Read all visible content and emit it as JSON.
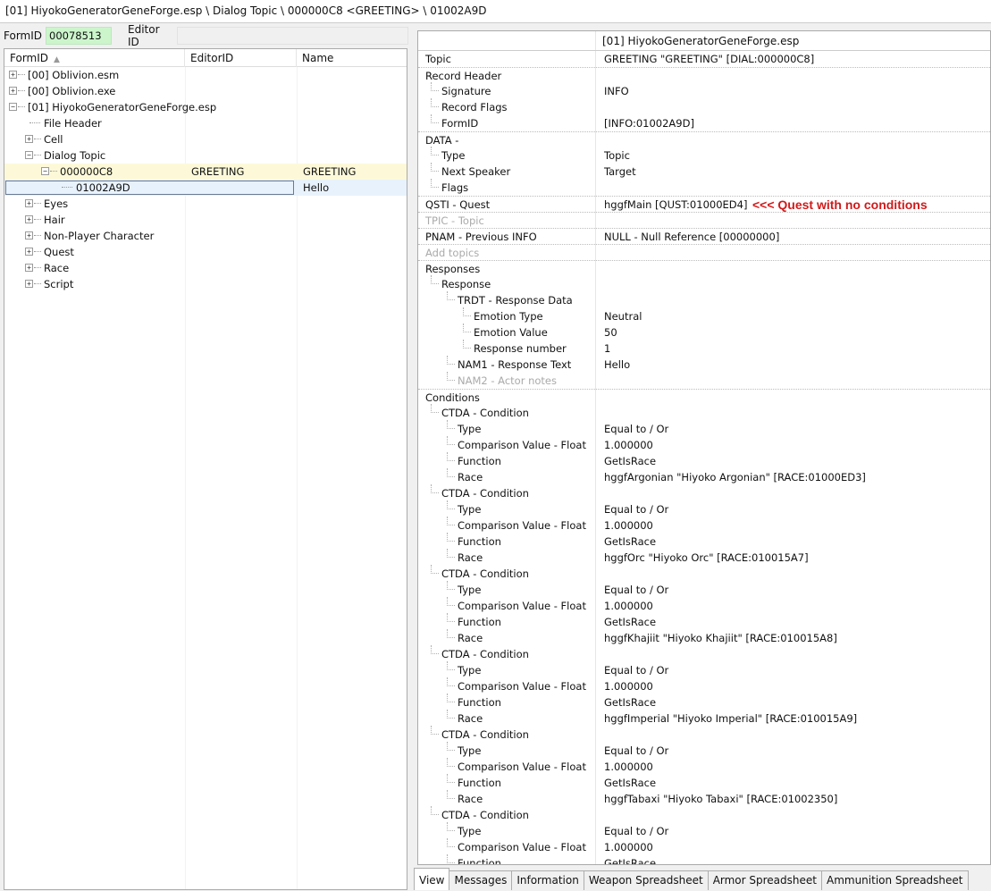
{
  "path": "[01] HiyokoGeneratorGeneForge.esp \\ Dialog Topic \\ 000000C8 <GREETING> \\ 01002A9D",
  "filter": {
    "formid_label": "FormID",
    "formid_value": "00078513",
    "editorid_label": "Editor ID"
  },
  "tree": {
    "columns": [
      "FormID",
      "EditorID",
      "Name"
    ],
    "rows": [
      {
        "label": "[00] Oblivion.esm",
        "editor": "",
        "name": ""
      },
      {
        "label": "[00] Oblivion.exe",
        "editor": "",
        "name": ""
      },
      {
        "label": "[01] HiyokoGeneratorGeneForge.esp",
        "editor": "",
        "name": ""
      },
      {
        "label": "File Header",
        "editor": "",
        "name": ""
      },
      {
        "label": "Cell",
        "editor": "",
        "name": ""
      },
      {
        "label": "Dialog Topic",
        "editor": "",
        "name": ""
      },
      {
        "label": "000000C8",
        "editor": "GREETING",
        "name": "GREETING"
      },
      {
        "label": "01002A9D",
        "editor": "",
        "name": "Hello"
      },
      {
        "label": "Eyes",
        "editor": "",
        "name": ""
      },
      {
        "label": "Hair",
        "editor": "",
        "name": ""
      },
      {
        "label": "Non-Player Character",
        "editor": "",
        "name": ""
      },
      {
        "label": "Quest",
        "editor": "",
        "name": ""
      },
      {
        "label": "Race",
        "editor": "",
        "name": ""
      },
      {
        "label": "Script",
        "editor": "",
        "name": ""
      }
    ]
  },
  "record": {
    "file_header": "[01] HiyokoGeneratorGeneForge.esp",
    "annotation": "<<< Quest with no conditions",
    "rows": [
      {
        "label": "Topic",
        "value": "GREETING \"GREETING\" [DIAL:000000C8]"
      },
      {
        "label": "Record Header",
        "value": ""
      },
      {
        "label": "Signature",
        "value": "INFO"
      },
      {
        "label": "Record Flags",
        "value": ""
      },
      {
        "label": "FormID",
        "value": "[INFO:01002A9D]"
      },
      {
        "label": "DATA -",
        "value": ""
      },
      {
        "label": "Type",
        "value": "Topic"
      },
      {
        "label": "Next Speaker",
        "value": "Target"
      },
      {
        "label": "Flags",
        "value": ""
      },
      {
        "label": "QSTI - Quest",
        "value": "hggfMain [QUST:01000ED4]"
      },
      {
        "label": "TPIC - Topic",
        "value": ""
      },
      {
        "label": "PNAM - Previous INFO",
        "value": "NULL - Null Reference [00000000]"
      },
      {
        "label": "Add topics",
        "value": ""
      },
      {
        "label": "Responses",
        "value": ""
      },
      {
        "label": "Response",
        "value": ""
      },
      {
        "label": "TRDT - Response Data",
        "value": ""
      },
      {
        "label": "Emotion Type",
        "value": "Neutral"
      },
      {
        "label": "Emotion Value",
        "value": "50"
      },
      {
        "label": "Response number",
        "value": "1"
      },
      {
        "label": "NAM1 - Response Text",
        "value": "Hello"
      },
      {
        "label": "NAM2 - Actor notes",
        "value": ""
      },
      {
        "label": "Conditions",
        "value": ""
      },
      {
        "label": "CTDA - Condition",
        "value": ""
      },
      {
        "label": "Type",
        "value": "Equal to / Or"
      },
      {
        "label": "Comparison Value - Float",
        "value": "1.000000"
      },
      {
        "label": "Function",
        "value": "GetIsRace"
      },
      {
        "label": "Race",
        "value": "hggfArgonian \"Hiyoko Argonian\" [RACE:01000ED3]"
      },
      {
        "label": "CTDA - Condition",
        "value": ""
      },
      {
        "label": "Type",
        "value": "Equal to / Or"
      },
      {
        "label": "Comparison Value - Float",
        "value": "1.000000"
      },
      {
        "label": "Function",
        "value": "GetIsRace"
      },
      {
        "label": "Race",
        "value": "hggfOrc \"Hiyoko Orc\" [RACE:010015A7]"
      },
      {
        "label": "CTDA - Condition",
        "value": ""
      },
      {
        "label": "Type",
        "value": "Equal to / Or"
      },
      {
        "label": "Comparison Value - Float",
        "value": "1.000000"
      },
      {
        "label": "Function",
        "value": "GetIsRace"
      },
      {
        "label": "Race",
        "value": "hggfKhajiit \"Hiyoko Khajiit\" [RACE:010015A8]"
      },
      {
        "label": "CTDA - Condition",
        "value": ""
      },
      {
        "label": "Type",
        "value": "Equal to / Or"
      },
      {
        "label": "Comparison Value - Float",
        "value": "1.000000"
      },
      {
        "label": "Function",
        "value": "GetIsRace"
      },
      {
        "label": "Race",
        "value": "hggfImperial \"Hiyoko Imperial\" [RACE:010015A9]"
      },
      {
        "label": "CTDA - Condition",
        "value": ""
      },
      {
        "label": "Type",
        "value": "Equal to / Or"
      },
      {
        "label": "Comparison Value - Float",
        "value": "1.000000"
      },
      {
        "label": "Function",
        "value": "GetIsRace"
      },
      {
        "label": "Race",
        "value": "hggfTabaxi \"Hiyoko Tabaxi\" [RACE:01002350]"
      },
      {
        "label": "CTDA - Condition",
        "value": ""
      },
      {
        "label": "Type",
        "value": "Equal to / Or"
      },
      {
        "label": "Comparison Value - Float",
        "value": "1.000000"
      },
      {
        "label": "Function",
        "value": "GetIsRace"
      }
    ]
  },
  "tabs": [
    "View",
    "Messages",
    "Information",
    "Weapon Spreadsheet",
    "Armor Spreadsheet",
    "Ammunition Spreadsheet"
  ],
  "colors": {
    "annotation": "#d21a1a",
    "formid_bg": "#ccf5cc",
    "highlight_row": "#fdf9d8",
    "selected_row": "#e8f2fd"
  }
}
